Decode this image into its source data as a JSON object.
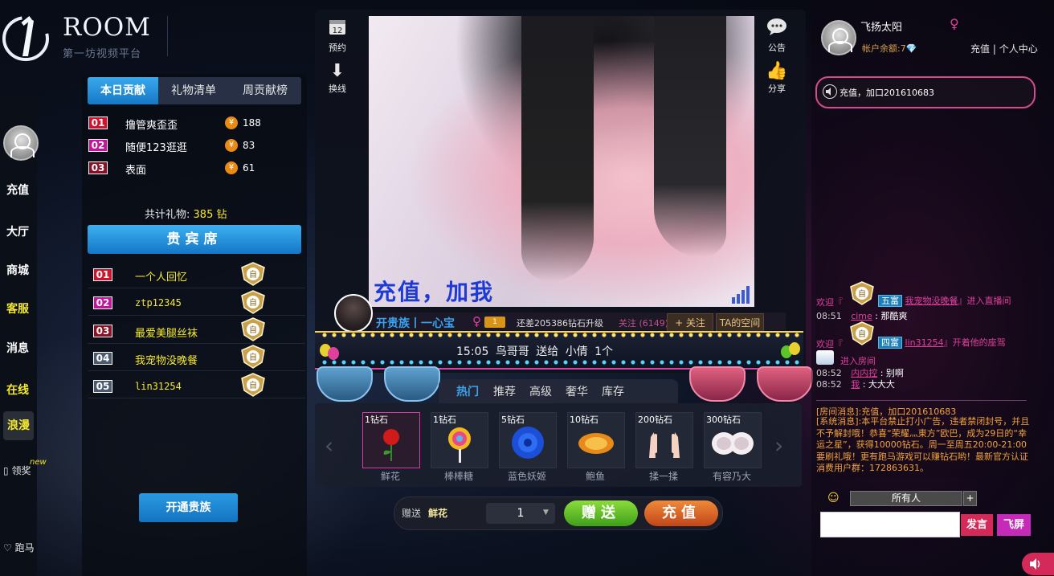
{
  "logo": {
    "title": "ROOM",
    "subtitle": "第一坊视频平台"
  },
  "leftnav": {
    "items": [
      {
        "label": "充值",
        "style": "white"
      },
      {
        "label": "大厅",
        "style": "white"
      },
      {
        "label": "商城",
        "style": "white"
      },
      {
        "label": "客服",
        "style": "yellow"
      },
      {
        "label": "消息",
        "style": "white"
      },
      {
        "label": "在线",
        "style": "yellow"
      },
      {
        "label": "浪漫",
        "style": "yellow-active"
      }
    ],
    "reward": {
      "label": "领奖",
      "tag": "new"
    },
    "race": {
      "label": "跑马"
    }
  },
  "rank": {
    "tabs": [
      "本日贡献",
      "礼物清单",
      "周贡献榜"
    ],
    "active_tab": 0,
    "rows": [
      {
        "num": "01",
        "name": "撸管爽歪歪",
        "value": "188"
      },
      {
        "num": "02",
        "name": "随便123逛逛",
        "value": "83"
      },
      {
        "num": "03",
        "name": "表面",
        "value": "61"
      }
    ],
    "coin_symbol": "¥",
    "total_label": "共计礼物:",
    "total_value": "385 钻"
  },
  "vip": {
    "title": "贵宾席",
    "rows": [
      {
        "num": "01",
        "name": "一个人回忆"
      },
      {
        "num": "02",
        "name": "ztp12345"
      },
      {
        "num": "03",
        "name": "最爱美腿丝袜"
      },
      {
        "num": "04",
        "name": "我宠物没晚餐"
      },
      {
        "num": "05",
        "name": "lin31254"
      }
    ],
    "badge_char": "自",
    "open_button": "开通贵族"
  },
  "stage": {
    "icons": {
      "book": {
        "label": "预约",
        "icon": "calendar-icon",
        "glyph": "12"
      },
      "switch": {
        "label": "换线",
        "icon": "down-arrow-icon"
      },
      "notice": {
        "label": "公告",
        "icon": "chat-bubble-icon"
      },
      "share": {
        "label": "分享",
        "icon": "thumbs-up-icon"
      }
    },
    "video_caption": "充值，加我",
    "host": {
      "name": "开贵族丨一心宝",
      "level_badge": "1",
      "upgrade_text": "还差205386钻石升级",
      "follow_count": "关注 (6149)",
      "follow_button": "+ 关注",
      "space_button": "TA的空间"
    },
    "marquee": {
      "time": "15:05",
      "text": "鸟哥哥 送给 小倩",
      "count": "1个"
    }
  },
  "gifts": {
    "tabs": [
      "热门",
      "推荐",
      "高级",
      "奢华",
      "库存"
    ],
    "active_tab": 0,
    "items": [
      {
        "price": "1钻石",
        "name": "鲜花",
        "icon": "rose-icon",
        "selected": true
      },
      {
        "price": "1钻石",
        "name": "棒棒糖",
        "icon": "lollipop-icon",
        "selected": false
      },
      {
        "price": "5钻石",
        "name": "蓝色妖姬",
        "icon": "blue-rose-icon",
        "selected": false
      },
      {
        "price": "10钻石",
        "name": "鲍鱼",
        "icon": "abalone-icon",
        "selected": false
      },
      {
        "price": "200钻石",
        "name": "揉一揉",
        "icon": "hands-icon",
        "selected": false
      },
      {
        "price": "300钻石",
        "name": "有容乃大",
        "icon": "bra-icon",
        "selected": false
      }
    ],
    "send": {
      "label": "赠送",
      "gift": "鲜花",
      "quantity": "1",
      "send_button": "赠送",
      "charge_button": "充值"
    }
  },
  "user": {
    "name": "飞扬太阳",
    "balance_label": "帐户余额:",
    "balance_value": "7",
    "links": {
      "charge": "充值",
      "sep": "|",
      "center": "个人中心"
    }
  },
  "notice_text": "充值，加口201610683",
  "chat": {
    "msg1": {
      "welcome": "欢迎『",
      "level": "五富",
      "user": "我宠物没晚餐",
      "action": "』进入直播间"
    },
    "line2": {
      "time": "08:51",
      "user": "cime",
      "sep": ":",
      "text": "那酷爽"
    },
    "msg3": {
      "welcome": "欢迎『",
      "level": "四富",
      "user": "lin31254",
      "action": "』开着他的座驾"
    },
    "msg3b": {
      "text": "进入房间"
    },
    "line4": {
      "time": "08:52",
      "user": "内内控",
      "sep": ":",
      "text": "别啊"
    },
    "line5": {
      "time": "08:52",
      "user": "我",
      "sep": ":",
      "text": "大大大"
    },
    "room_msg": "[房间消息]:充值，加口201610683",
    "sys_msg": "[系统消息]:本平台禁止打小广告，违者禁闭封号，并且不予解封哦！恭喜“荣耀灬東方”欧巴，成为29日的“幸运之星”，获得10000钻石。周一至周五20:00-21:00要刷礼哦！更有跑马游戏可以赚钻石哟！最新官方认证消费用户群：172863631。"
  },
  "compose": {
    "to": "所有人",
    "plus": "+",
    "say_button": "发言",
    "fly_button": "飞屏"
  },
  "colors": {
    "accent_blue": "#1a8ad8",
    "pink": "#e0409c",
    "yellow": "#f5e92e",
    "green": "#5cc52a",
    "orange": "#e0692a"
  }
}
